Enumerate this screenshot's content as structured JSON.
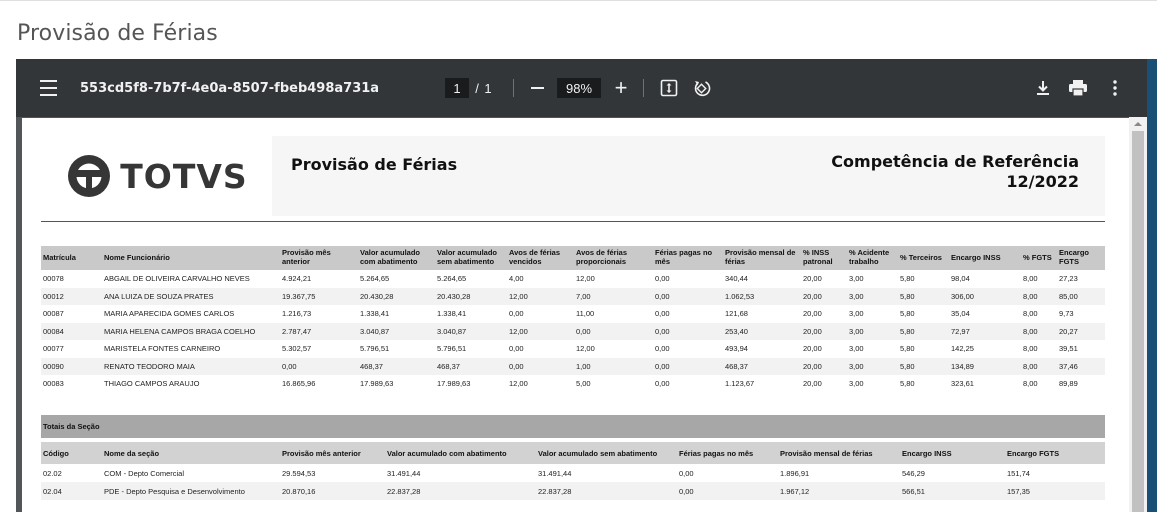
{
  "page": {
    "title": "Provisão de Férias"
  },
  "toolbar": {
    "document_name": "553cd5f8-7b7f-4e0a-8507-fbeb498a731a",
    "current_page": "1",
    "page_separator": "/",
    "total_pages": "1",
    "zoom": "98%",
    "zoom_in_label": "+",
    "icons": [
      "menu-icon",
      "zoom-out-icon",
      "zoom-in-icon",
      "fit-page-icon",
      "rotate-icon",
      "download-icon",
      "print-icon",
      "more-vertical-icon"
    ]
  },
  "report": {
    "logo_text": "TOTVS",
    "title": "Provisão de Férias",
    "competence_label": "Competência de Referência",
    "competence_value": "12/2022",
    "employee_columns": [
      "Matrícula",
      "Nome Funcionário",
      "Provisão mês anterior",
      "Valor acumulado com abatimento",
      "Valor acumulado sem abatimento",
      "Avos de férias vencidos",
      "Avos de férias proporcionais",
      "Férias pagas no mês",
      "Provisão mensal de férias",
      "% INSS patronal",
      "% Acidente trabalho",
      "% Terceiros",
      "Encargo INSS",
      "% FGTS",
      "Encargo FGTS"
    ],
    "employees": [
      [
        "00078",
        "ABGAIL DE OLIVEIRA CARVALHO NEVES",
        "4.924,21",
        "5.264,65",
        "5.264,65",
        "4,00",
        "12,00",
        "0,00",
        "340,44",
        "20,00",
        "3,00",
        "5,80",
        "98,04",
        "8,00",
        "27,23"
      ],
      [
        "00012",
        "ANA LUIZA  DE SOUZA PRATES",
        "19.367,75",
        "20.430,28",
        "20.430,28",
        "12,00",
        "7,00",
        "0,00",
        "1.062,53",
        "20,00",
        "3,00",
        "5,80",
        "306,00",
        "8,00",
        "85,00"
      ],
      [
        "00087",
        "MARIA APARECIDA GOMES CARLOS",
        "1.216,73",
        "1.338,41",
        "1.338,41",
        "0,00",
        "11,00",
        "0,00",
        "121,68",
        "20,00",
        "3,00",
        "5,80",
        "35,04",
        "8,00",
        "9,73"
      ],
      [
        "00084",
        "MARIA HELENA CAMPOS BRAGA COELHO",
        "2.787,47",
        "3.040,87",
        "3.040,87",
        "12,00",
        "0,00",
        "0,00",
        "253,40",
        "20,00",
        "3,00",
        "5,80",
        "72,97",
        "8,00",
        "20,27"
      ],
      [
        "00077",
        "MARISTELA FONTES CARNEIRO",
        "5.302,57",
        "5.796,51",
        "5.796,51",
        "0,00",
        "12,00",
        "0,00",
        "493,94",
        "20,00",
        "3,00",
        "5,80",
        "142,25",
        "8,00",
        "39,51"
      ],
      [
        "00090",
        "RENATO TEODORO MAIA",
        "0,00",
        "468,37",
        "468,37",
        "0,00",
        "1,00",
        "0,00",
        "468,37",
        "20,00",
        "3,00",
        "5,80",
        "134,89",
        "8,00",
        "37,46"
      ],
      [
        "00083",
        "THIAGO CAMPOS ARAUJO",
        "16.865,96",
        "17.989,63",
        "17.989,63",
        "12,00",
        "5,00",
        "0,00",
        "1.123,67",
        "20,00",
        "3,00",
        "5,80",
        "323,61",
        "8,00",
        "89,89"
      ]
    ],
    "totals_title": "Totais da Seção",
    "section_columns": [
      "Código",
      "Nome da seção",
      "Provisão mês anterior",
      "Valor acumulado com abatimento",
      "Valor acumulado sem abatimento",
      "Férias pagas no mês",
      "Provisão mensal de férias",
      "Encargo INSS",
      "Encargo FGTS"
    ],
    "sections": [
      [
        "02.02",
        "COM - Depto Comercial",
        "29.594,53",
        "31.491,44",
        "31.491,44",
        "0,00",
        "1.896,91",
        "546,29",
        "151,74"
      ],
      [
        "02.04",
        "PDE - Depto Pesquisa e Desenvolvimento",
        "20.870,16",
        "22.837,28",
        "22.837,28",
        "0,00",
        "1.967,12",
        "566,51",
        "157,35"
      ]
    ]
  }
}
